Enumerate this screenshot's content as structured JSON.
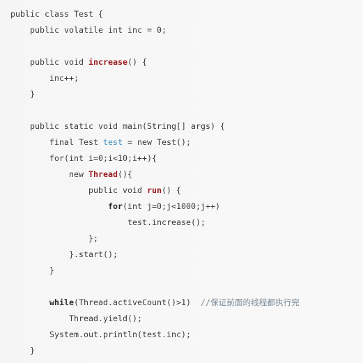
{
  "editor": {
    "language": "java",
    "background_color": "#f7f7f7",
    "default_text_color": "#3a3a3a",
    "keyword_color": "#2b2b2b",
    "method_color": "#9b1c21",
    "variable_color": "#3f8fc4",
    "comment_color": "#7a8a96",
    "indent_unit": "    ",
    "line_count": 18
  },
  "code": {
    "lines": [
      {
        "index": 0,
        "indent": 0,
        "text": "public class Test {",
        "tokens": [
          {
            "t": "public class Test {",
            "k": "plain"
          }
        ]
      },
      {
        "index": 1,
        "indent": 1,
        "text": "    public volatile int inc = 0;",
        "tokens": [
          {
            "t": "    public volatile int inc = 0;",
            "k": "plain"
          }
        ]
      },
      {
        "index": 2,
        "indent": 0,
        "text": "",
        "tokens": []
      },
      {
        "index": 3,
        "indent": 1,
        "text": "    public void increase() {",
        "tokens": [
          {
            "t": "    public void ",
            "k": "plain"
          },
          {
            "t": "increase",
            "k": "method"
          },
          {
            "t": "() {",
            "k": "plain"
          }
        ]
      },
      {
        "index": 4,
        "indent": 2,
        "text": "        inc++;",
        "tokens": [
          {
            "t": "        inc++;",
            "k": "plain"
          }
        ]
      },
      {
        "index": 5,
        "indent": 1,
        "text": "    }",
        "tokens": [
          {
            "t": "    }",
            "k": "plain"
          }
        ]
      },
      {
        "index": 6,
        "indent": 0,
        "text": "",
        "tokens": []
      },
      {
        "index": 7,
        "indent": 1,
        "text": "    public static void main(String[] args) {",
        "tokens": [
          {
            "t": "    public static void main(String[] args) {",
            "k": "plain"
          }
        ]
      },
      {
        "index": 8,
        "indent": 2,
        "text": "        final Test test = new Test();",
        "tokens": [
          {
            "t": "        final Test ",
            "k": "plain"
          },
          {
            "t": "test",
            "k": "var"
          },
          {
            "t": " = new Test();",
            "k": "plain"
          }
        ]
      },
      {
        "index": 9,
        "indent": 2,
        "text": "        for(int i=0;i<10;i++){",
        "tokens": [
          {
            "t": "        for(int i=0;i<10;i++){",
            "k": "plain"
          }
        ]
      },
      {
        "index": 10,
        "indent": 3,
        "text": "            new Thread(){",
        "tokens": [
          {
            "t": "            new ",
            "k": "plain"
          },
          {
            "t": "Thread",
            "k": "type"
          },
          {
            "t": "(){",
            "k": "plain"
          }
        ]
      },
      {
        "index": 11,
        "indent": 4,
        "text": "                public void run() {",
        "tokens": [
          {
            "t": "                public void ",
            "k": "plain"
          },
          {
            "t": "run",
            "k": "method"
          },
          {
            "t": "() {",
            "k": "plain"
          }
        ]
      },
      {
        "index": 12,
        "indent": 5,
        "text": "                    for(int j=0;j<1000;j++)",
        "tokens": [
          {
            "t": "                    ",
            "k": "plain"
          },
          {
            "t": "for",
            "k": "kw"
          },
          {
            "t": "(int j=0;j<1000;j++)",
            "k": "plain"
          }
        ]
      },
      {
        "index": 13,
        "indent": 6,
        "text": "                        test.increase();",
        "tokens": [
          {
            "t": "                        test.increase();",
            "k": "plain"
          }
        ]
      },
      {
        "index": 14,
        "indent": 4,
        "text": "                };",
        "tokens": [
          {
            "t": "                };",
            "k": "plain"
          }
        ]
      },
      {
        "index": 15,
        "indent": 3,
        "text": "            }.start();",
        "tokens": [
          {
            "t": "            }.start();",
            "k": "plain"
          }
        ]
      },
      {
        "index": 16,
        "indent": 2,
        "text": "        }",
        "tokens": [
          {
            "t": "        }",
            "k": "plain"
          }
        ]
      },
      {
        "index": 17,
        "indent": 0,
        "text": "",
        "tokens": []
      },
      {
        "index": 18,
        "indent": 2,
        "text": "        while(Thread.activeCount()>1)  //保证前面的线程都执行完",
        "tokens": [
          {
            "t": "        ",
            "k": "plain"
          },
          {
            "t": "while",
            "k": "kw"
          },
          {
            "t": "(Thread.activeCount()>1)  ",
            "k": "plain"
          },
          {
            "t": "//保证前面的线程都执行完",
            "k": "comment"
          }
        ]
      },
      {
        "index": 19,
        "indent": 3,
        "text": "            Thread.yield();",
        "tokens": [
          {
            "t": "            Thread.yield();",
            "k": "plain"
          }
        ]
      },
      {
        "index": 20,
        "indent": 2,
        "text": "        System.out.println(test.inc);",
        "tokens": [
          {
            "t": "        System.out.println(test.inc);",
            "k": "plain"
          }
        ]
      },
      {
        "index": 21,
        "indent": 1,
        "text": "    }",
        "tokens": [
          {
            "t": "    }",
            "k": "plain"
          }
        ]
      }
    ]
  }
}
